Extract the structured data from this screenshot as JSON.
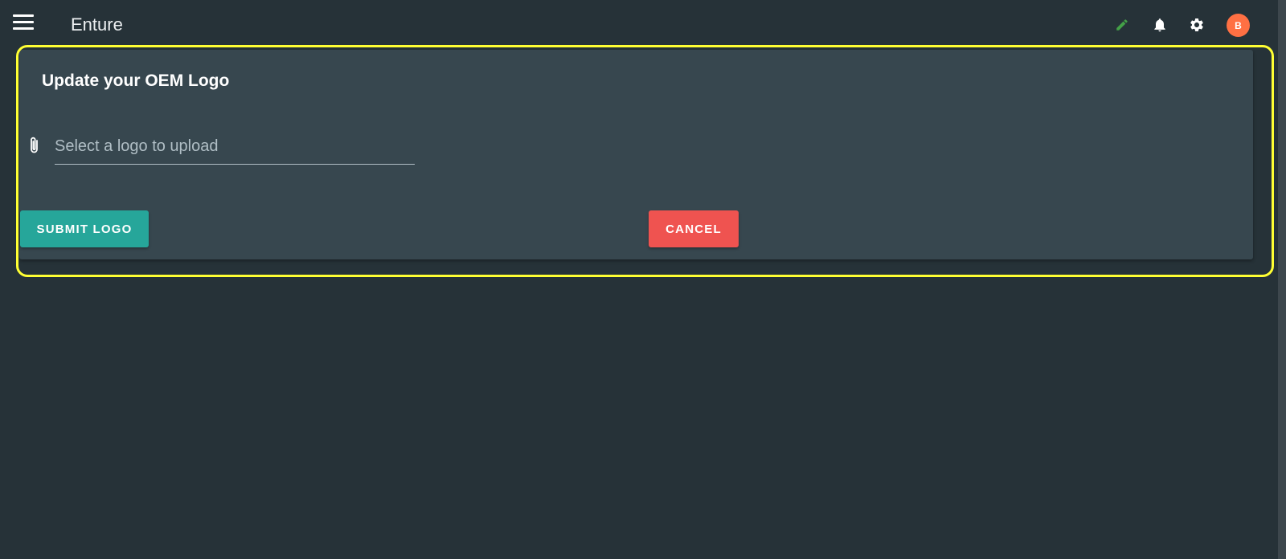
{
  "app": {
    "title": "Enture"
  },
  "header": {
    "menu_icon": "hamburger-menu-icon",
    "icons": [
      "pencil-icon",
      "bell-icon",
      "gear-icon"
    ],
    "avatar_initial": "B",
    "colors": {
      "pencil": "#43a047",
      "avatar": "#ff7043"
    }
  },
  "card": {
    "title": "Update your OEM Logo",
    "upload_icon": "paperclip-icon",
    "upload_placeholder": "Select a logo to upload",
    "submit_label": "SUBMIT LOGO",
    "cancel_label": "CANCEL"
  },
  "colors": {
    "background": "#263238",
    "card": "#37474f",
    "submit": "#26a69a",
    "cancel": "#ef5350",
    "highlight": "#ffff33"
  }
}
